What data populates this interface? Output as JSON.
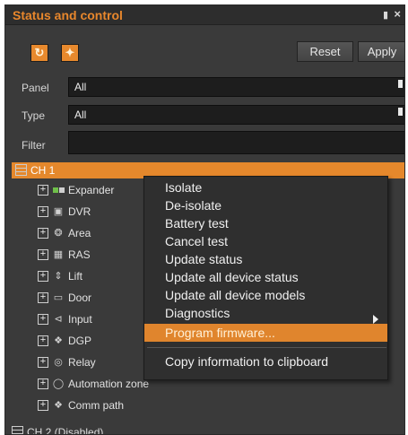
{
  "window": {
    "title": "Status and control",
    "pin_glyph": "🔒",
    "close_glyph": "×"
  },
  "toolbar": {
    "refresh_icon": "refresh-icon",
    "wand_icon": "wand-icon",
    "reset_label": "Reset",
    "apply_label": "Apply"
  },
  "filters": {
    "panel_label": "Panel",
    "panel_value": "All",
    "type_label": "Type",
    "type_value": "All",
    "filter_label": "Filter",
    "filter_value": ""
  },
  "tree": {
    "ch1_label": "CH 1",
    "children": [
      {
        "label": "Expander",
        "icon": "expander-icon"
      },
      {
        "label": "DVR",
        "icon": "dvr-icon"
      },
      {
        "label": "Area",
        "icon": "area-icon"
      },
      {
        "label": "RAS",
        "icon": "ras-icon"
      },
      {
        "label": "Lift",
        "icon": "lift-icon"
      },
      {
        "label": "Door",
        "icon": "door-icon"
      },
      {
        "label": "Input",
        "icon": "input-icon"
      },
      {
        "label": "DGP",
        "icon": "dgp-icon"
      },
      {
        "label": "Relay",
        "icon": "relay-icon"
      },
      {
        "label": "Automation zone",
        "icon": "automation-zone-icon"
      },
      {
        "label": "Comm path",
        "icon": "comm-path-icon"
      }
    ],
    "ch2_label": "CH 2 (Disabled)"
  },
  "context_menu": {
    "items": [
      "Isolate",
      "De-isolate",
      "Battery test",
      "Cancel test",
      "Update status",
      "Update all device status",
      "Update all device models",
      "Diagnostics",
      "Program firmware...",
      "Copy information to clipboard"
    ],
    "highlighted_index": 8
  },
  "colors": {
    "accent": "#e5882c",
    "panel_bg": "#3a3a3a",
    "menu_bg": "#2f2f2f"
  }
}
